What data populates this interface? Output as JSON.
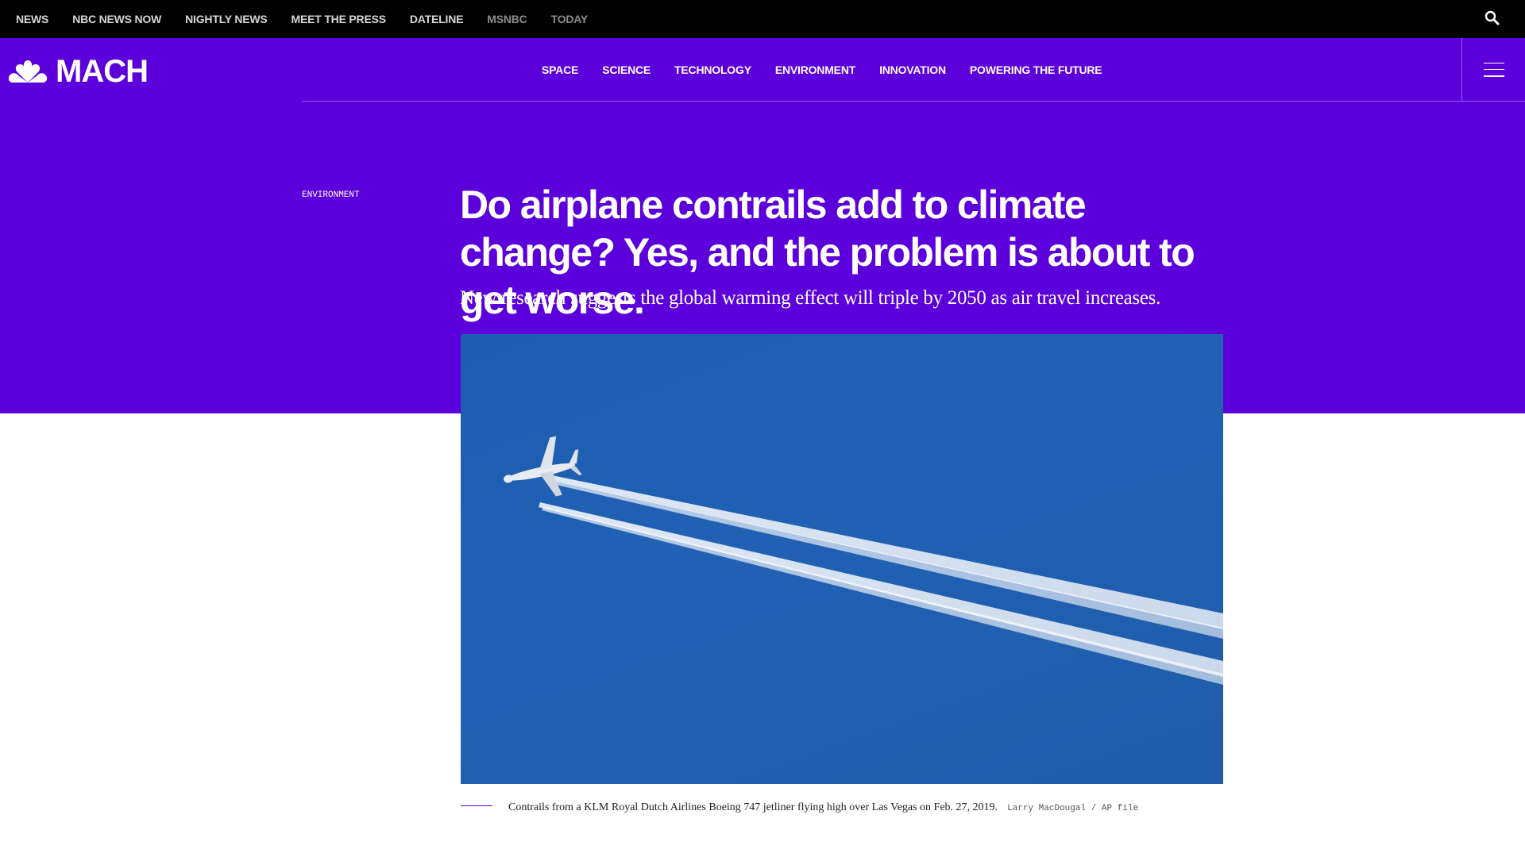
{
  "topbar": {
    "links": [
      "NEWS",
      "NBC NEWS NOW",
      "NIGHTLY NEWS",
      "MEET THE PRESS",
      "DATELINE",
      "MSNBC",
      "TODAY"
    ],
    "search_icon": "search-icon"
  },
  "brand": {
    "logo_icon": "nbc-peacock-icon",
    "name": "MACH"
  },
  "section_nav": {
    "items": [
      "SPACE",
      "SCIENCE",
      "TECHNOLOGY",
      "ENVIRONMENT",
      "INNOVATION",
      "POWERING THE FUTURE"
    ],
    "menu_icon": "hamburger-menu-icon"
  },
  "article": {
    "eyebrow": "ENVIRONMENT",
    "headline": "Do airplane contrails add to climate change? Yes, and the problem is about to get worse.",
    "dek": "New research suggests the global warming effect will triple by 2050 as air travel increases.",
    "caption": "Contrails from a KLM Royal Dutch Airlines Boeing 747 jetliner flying high over Las Vegas on Feb. 27, 2019.",
    "credit": "Larry MacDougal / AP file"
  },
  "colors": {
    "brand_purple": "#5c00db",
    "topbar_black": "#000000",
    "sky_blue": "#1f5cac"
  }
}
